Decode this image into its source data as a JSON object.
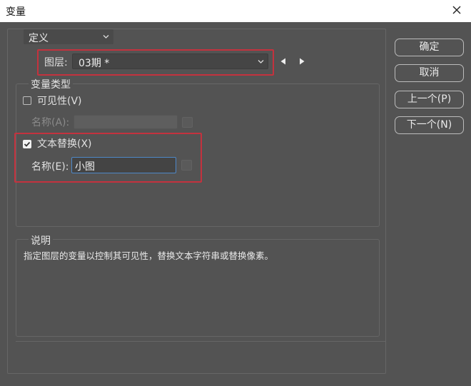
{
  "window": {
    "title": "变量"
  },
  "mode": {
    "value": "定义"
  },
  "layer": {
    "label": "图层:",
    "value": "03期 *"
  },
  "variable_types": {
    "title": "变量类型",
    "visibility": {
      "label": "可见性(V)",
      "checked": false,
      "name_label": "名称(A):",
      "name_value": ""
    },
    "text_replace": {
      "label": "文本替换(X)",
      "checked": true,
      "name_label": "名称(E):",
      "name_value": "小图"
    }
  },
  "description": {
    "title": "说明",
    "text": "指定图层的变量以控制其可见性，替换文本字符串或替换像素。"
  },
  "buttons": {
    "ok": "确定",
    "cancel": "取消",
    "prev": "上一个(P)",
    "next": "下一个(N)"
  },
  "colors": {
    "background": "#535353",
    "highlight_red": "#c4323e",
    "focus_blue": "#4e88c8"
  }
}
